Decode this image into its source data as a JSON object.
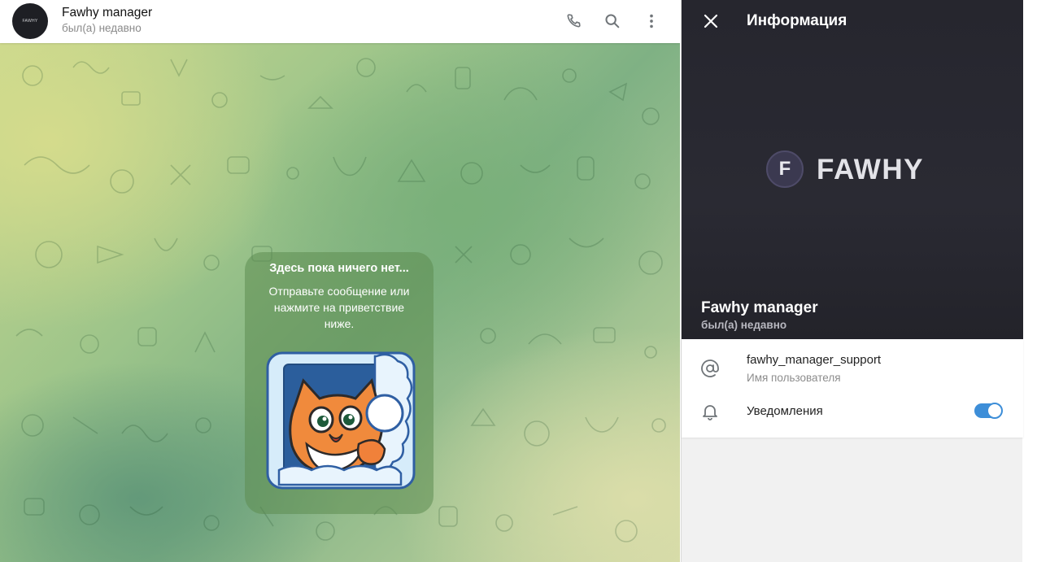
{
  "header": {
    "avatar_text": "FAWHY",
    "name": "Fawhy manager",
    "status": "был(а) недавно"
  },
  "empty_state": {
    "title": "Здесь пока ничего нет...",
    "text": "Отправьте сообщение или нажмите на приветствие ниже."
  },
  "info_panel": {
    "title": "Информация",
    "brand_letter": "F",
    "brand_text": "FAWHY",
    "name": "Fawhy manager",
    "status": "был(а) недавно",
    "username": "fawhy_manager_support",
    "username_caption": "Имя пользователя",
    "notifications_label": "Уведомления",
    "notifications_on": true
  },
  "colors": {
    "accent": "#3d8ed8",
    "hero_bg": "#26262e"
  },
  "icons": {
    "call": "phone-icon",
    "search": "search-icon",
    "menu": "more-vertical-icon",
    "close": "close-icon",
    "username": "at-sign-icon",
    "notifications": "bell-icon"
  }
}
